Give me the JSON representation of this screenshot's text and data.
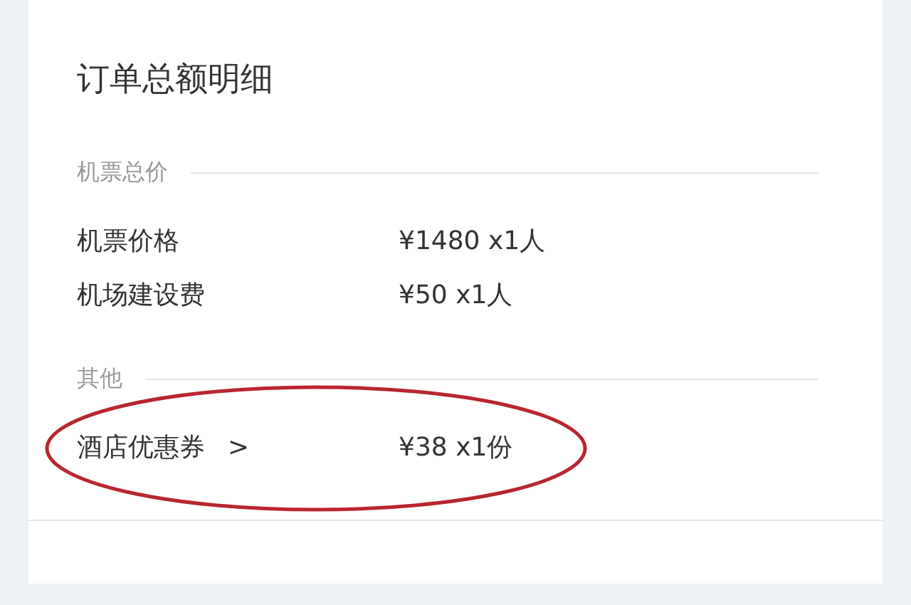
{
  "title": "订单总额明细",
  "sections": [
    {
      "heading": "机票总价",
      "rows": [
        {
          "label": "机票价格",
          "value": "¥1480 x1人",
          "circled": false
        },
        {
          "label": "机场建设费",
          "value": "¥50 x1人",
          "circled": false
        }
      ]
    },
    {
      "heading": "其他",
      "rows": [
        {
          "label": "酒店优惠券",
          "arrow": ">",
          "value": "¥38 x1份",
          "circled": true
        }
      ]
    }
  ]
}
